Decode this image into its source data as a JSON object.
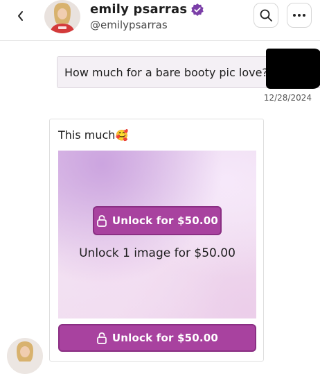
{
  "header": {
    "name": "emily psarras",
    "handle": "@emilypsarras",
    "icons": {
      "back": "chevron-left-icon",
      "verified": "verified-badge-icon",
      "search": "search-icon",
      "more": "more-horizontal-icon"
    },
    "verified_color": "#7b3fa8"
  },
  "messages": {
    "sent": {
      "text": "How much for a bare booty pic love?",
      "timestamp": "12/28/2024"
    },
    "received": {
      "text": "This much",
      "emoji": "🥰",
      "unlock_button_label": "Unlock for $50.00",
      "unlock_caption": "Unlock 1 image for $50.00",
      "unlock_button_bottom_label": "Unlock for $50.00"
    }
  },
  "colors": {
    "accent": "#a8429f",
    "sent_bubble_bg": "#f4f0f5"
  }
}
